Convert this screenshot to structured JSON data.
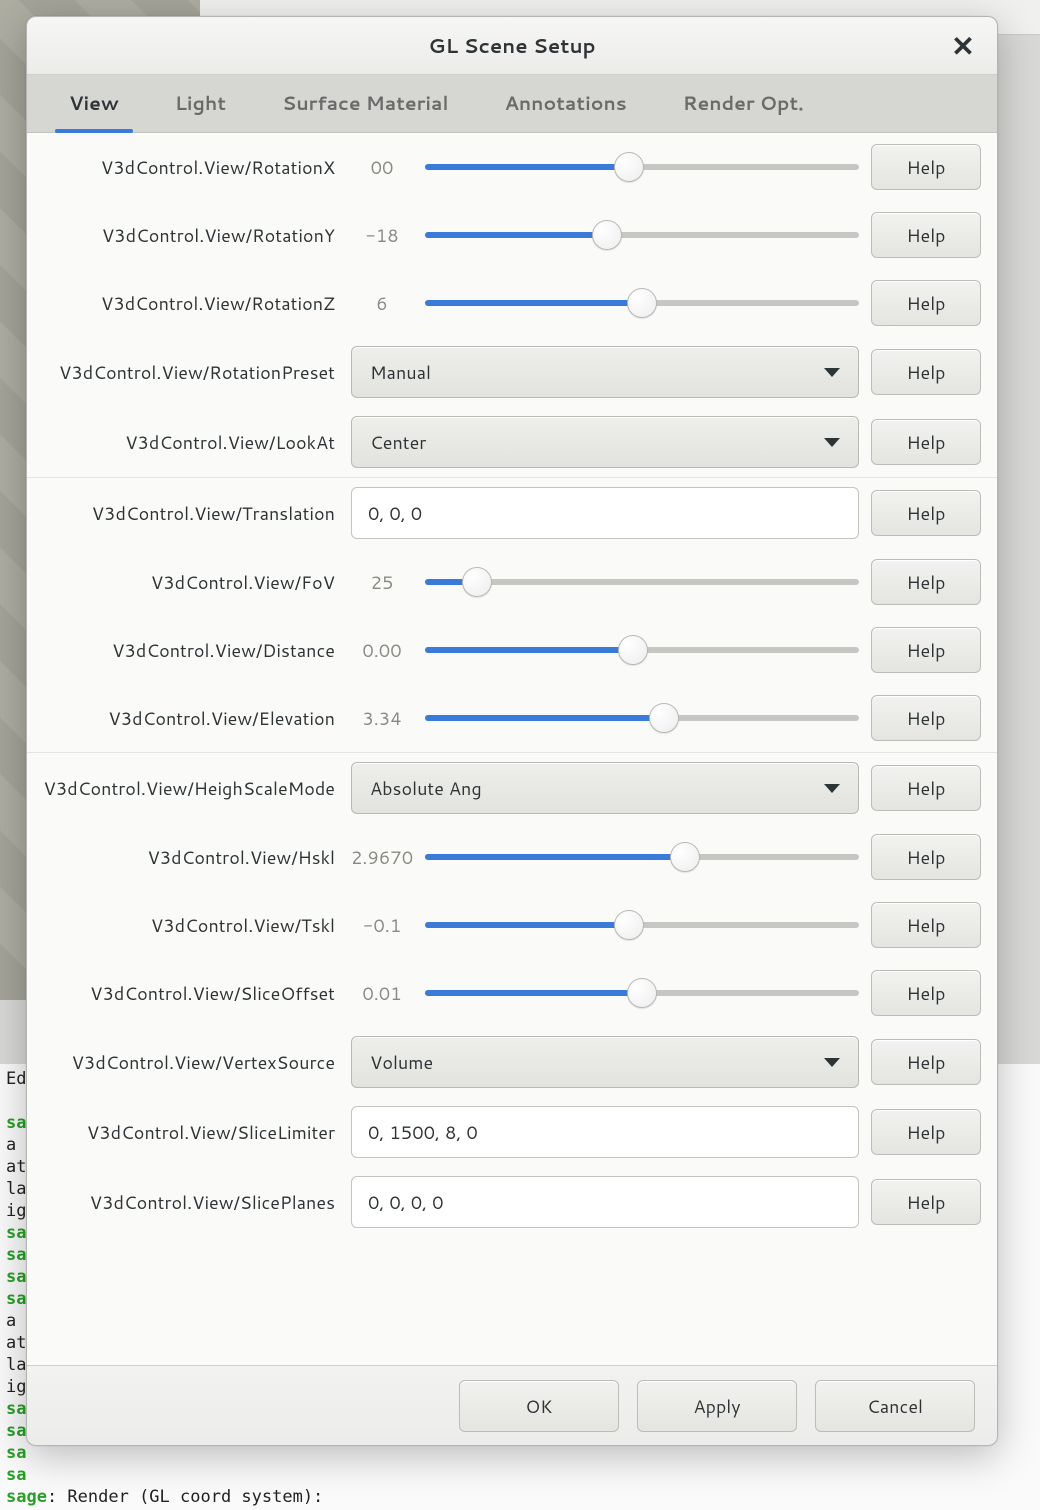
{
  "window": {
    "title": "GL Scene Setup"
  },
  "tabs": [
    {
      "label": "View",
      "active": true
    },
    {
      "label": "Light"
    },
    {
      "label": "Surface Material"
    },
    {
      "label": "Annotations"
    },
    {
      "label": "Render Opt."
    }
  ],
  "help_label": "Help",
  "footer": {
    "ok": "OK",
    "apply": "Apply",
    "cancel": "Cancel"
  },
  "rows": {
    "rotationX": {
      "label": "V3dControl.View/RotationX",
      "value": "00",
      "slider_pct": 47
    },
    "rotationY": {
      "label": "V3dControl.View/RotationY",
      "value": "-18",
      "slider_pct": 42
    },
    "rotationZ": {
      "label": "V3dControl.View/RotationZ",
      "value": "6",
      "slider_pct": 50
    },
    "rotationPreset": {
      "label": "V3dControl.View/RotationPreset",
      "selected": "Manual"
    },
    "lookAt": {
      "label": "V3dControl.View/LookAt",
      "selected": "Center"
    },
    "translation": {
      "label": "V3dControl.View/Translation",
      "text": "0, 0, 0"
    },
    "fov": {
      "label": "V3dControl.View/FoV",
      "value": "25",
      "slider_pct": 12
    },
    "distance": {
      "label": "V3dControl.View/Distance",
      "value": "0.00",
      "slider_pct": 48
    },
    "elevation": {
      "label": "V3dControl.View/Elevation",
      "value": "3.34",
      "slider_pct": 55
    },
    "heighScaleMode": {
      "label": "V3dControl.View/HeighScaleMode",
      "selected": "Absolute Ang"
    },
    "hskl": {
      "label": "V3dControl.View/Hskl",
      "value": "2.9670",
      "slider_pct": 60
    },
    "tskl": {
      "label": "V3dControl.View/Tskl",
      "value": "-0.1",
      "slider_pct": 47
    },
    "sliceOffset": {
      "label": "V3dControl.View/SliceOffset",
      "value": "0.01",
      "slider_pct": 50
    },
    "vertexSource": {
      "label": "V3dControl.View/VertexSource",
      "selected": "Volume"
    },
    "sliceLimiter": {
      "label": "V3dControl.View/SliceLimiter",
      "text": "0, 1500, 8, 0"
    },
    "slicePlanes": {
      "label": "V3dControl.View/SlicePlanes",
      "text": "0, 0, 0, 0"
    }
  },
  "console_lines": [
    {
      "prefix": "",
      "body": "Ed"
    },
    {
      "prefix": "",
      "body": ""
    },
    {
      "prefix": "sa",
      "body": ""
    },
    {
      "prefix": "",
      "body": "a"
    },
    {
      "prefix": "",
      "body": "at"
    },
    {
      "prefix": "",
      "body": "la"
    },
    {
      "prefix": "",
      "body": "ig"
    },
    {
      "prefix": "sa",
      "body": ""
    },
    {
      "prefix": "sa",
      "body": ""
    },
    {
      "prefix": "sa",
      "body": ""
    },
    {
      "prefix": "sa",
      "body": ""
    },
    {
      "prefix": "",
      "body": "a"
    },
    {
      "prefix": "",
      "body": "at"
    },
    {
      "prefix": "",
      "body": "la"
    },
    {
      "prefix": "",
      "body": "ig"
    },
    {
      "prefix": "sa",
      "body": ""
    },
    {
      "prefix": "sa",
      "body": ""
    },
    {
      "prefix": "sa",
      "body": ""
    },
    {
      "prefix": "sa",
      "body": ""
    },
    {
      "prefix": "sage",
      "body": ": Render (GL coord system):"
    }
  ]
}
